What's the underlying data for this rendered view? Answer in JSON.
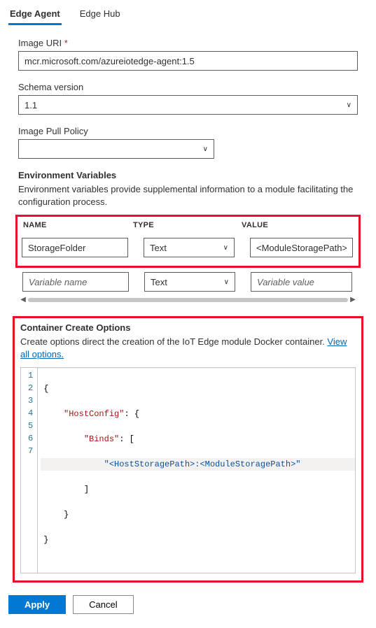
{
  "tabs": {
    "edge_agent": "Edge Agent",
    "edge_hub": "Edge Hub"
  },
  "image_uri": {
    "label": "Image URI",
    "value": "mcr.microsoft.com/azureiotedge-agent:1.5"
  },
  "schema_version": {
    "label": "Schema version",
    "value": "1.1"
  },
  "image_pull_policy": {
    "label": "Image Pull Policy",
    "value": ""
  },
  "env_vars": {
    "title": "Environment Variables",
    "desc": "Environment variables provide supplemental information to a module facilitating the configuration process.",
    "cols": {
      "name": "NAME",
      "type": "TYPE",
      "value": "VALUE"
    },
    "rows": [
      {
        "name": "StorageFolder",
        "type": "Text",
        "value": "<ModuleStoragePath>"
      }
    ],
    "placeholders": {
      "name": "Variable name",
      "type": "Text",
      "value": "Variable value"
    }
  },
  "cco": {
    "title": "Container Create Options",
    "desc_pre": "Create options direct the creation of the IoT Edge module Docker container. ",
    "link": "View all options."
  },
  "code": {
    "lines": [
      "1",
      "2",
      "3",
      "4",
      "5",
      "6",
      "7"
    ],
    "l1": "{",
    "l2_key": "\"HostConfig\"",
    "l2_suffix": ": {",
    "l3_key": "\"Binds\"",
    "l3_suffix": ": [",
    "l4_str": "\"<HostStoragePath>:<ModuleStoragePath>\"",
    "l5": "]",
    "l6": "}",
    "l7": "}"
  },
  "buttons": {
    "apply": "Apply",
    "cancel": "Cancel"
  }
}
